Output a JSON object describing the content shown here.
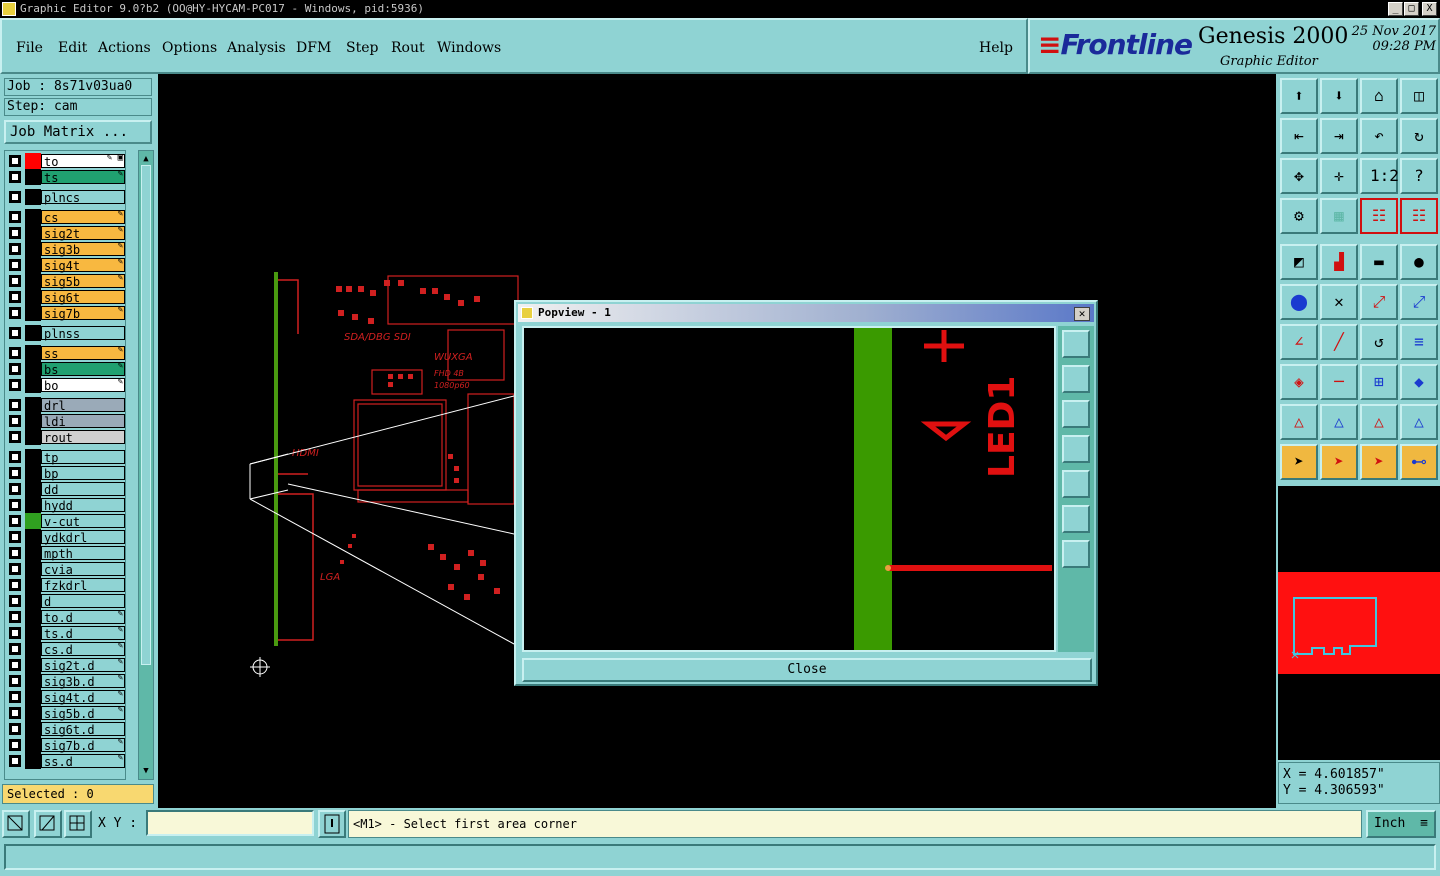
{
  "window": {
    "title": "Graphic Editor 9.0?b2 (OO@HY-HYCAM-PC017 - Windows, pid:5936)",
    "min": "_",
    "max": "□",
    "close": "X"
  },
  "menu": [
    "File",
    "Edit",
    "Actions",
    "Options",
    "Analysis",
    "DFM",
    "Step",
    "Rout",
    "Windows"
  ],
  "help": "Help",
  "brand": {
    "logo": "Frontline",
    "product": "Genesis 2000",
    "subtitle": "Graphic Editor",
    "date": "25 Nov 2017",
    "time": "09:28 PM"
  },
  "job": {
    "job_label": "Job : 8s71v03ua0",
    "step_label": "Step: cam",
    "matrix_button": "Job Matrix ..."
  },
  "layers": [
    {
      "name": "to",
      "color": "#ffffff",
      "swatch": "#ff0000",
      "icon": "✎ ▣"
    },
    {
      "name": "ts",
      "color": "#20a070",
      "swatch": "#000000",
      "icon": "✎"
    },
    {
      "name": "plncs",
      "color": "#8fd3d3",
      "swatch": "#000000",
      "icon": ""
    },
    {
      "name": "cs",
      "color": "#f8b840",
      "swatch": "#000000",
      "icon": "✎"
    },
    {
      "name": "sig2t",
      "color": "#f8b840",
      "swatch": "#000000",
      "icon": "✎"
    },
    {
      "name": "sig3b",
      "color": "#f8b840",
      "swatch": "#000000",
      "icon": "✎"
    },
    {
      "name": "sig4t",
      "color": "#f8b840",
      "swatch": "#000000",
      "icon": "✎"
    },
    {
      "name": "sig5b",
      "color": "#f8b840",
      "swatch": "#000000",
      "icon": "✎"
    },
    {
      "name": "sig6t",
      "color": "#f8b840",
      "swatch": "#000000",
      "icon": ""
    },
    {
      "name": "sig7b",
      "color": "#f8b840",
      "swatch": "#000000",
      "icon": "✎"
    },
    {
      "name": "plnss",
      "color": "#8fd3d3",
      "swatch": "#000000",
      "icon": ""
    },
    {
      "name": "ss",
      "color": "#f8b840",
      "swatch": "#000000",
      "icon": "✎"
    },
    {
      "name": "bs",
      "color": "#20a070",
      "swatch": "#000000",
      "icon": "✎"
    },
    {
      "name": "bo",
      "color": "#ffffff",
      "swatch": "#000000",
      "icon": "✎"
    },
    {
      "name": "drl",
      "color": "#9aaab8",
      "swatch": "#000000",
      "icon": ""
    },
    {
      "name": "ldi",
      "color": "#9aaab8",
      "swatch": "#000000",
      "icon": ""
    },
    {
      "name": "rout",
      "color": "#d0d0d0",
      "swatch": "#000000",
      "icon": ""
    },
    {
      "name": "tp",
      "color": "#8fd3d3",
      "swatch": "#000000",
      "icon": ""
    },
    {
      "name": "bp",
      "color": "#8fd3d3",
      "swatch": "#000000",
      "icon": ""
    },
    {
      "name": "dd",
      "color": "#8fd3d3",
      "swatch": "#000000",
      "icon": ""
    },
    {
      "name": "hydd",
      "color": "#8fd3d3",
      "swatch": "#000000",
      "icon": ""
    },
    {
      "name": "v-cut",
      "color": "#8fd3d3",
      "swatch": "#30a020",
      "icon": ""
    },
    {
      "name": "ydkdrl",
      "color": "#8fd3d3",
      "swatch": "#000000",
      "icon": ""
    },
    {
      "name": "mpth",
      "color": "#8fd3d3",
      "swatch": "#000000",
      "icon": ""
    },
    {
      "name": "cvia",
      "color": "#8fd3d3",
      "swatch": "#000000",
      "icon": ""
    },
    {
      "name": "fzkdrl",
      "color": "#8fd3d3",
      "swatch": "#000000",
      "icon": ""
    },
    {
      "name": "d",
      "color": "#8fd3d3",
      "swatch": "#000000",
      "icon": ""
    },
    {
      "name": "to.d",
      "color": "#8fd3d3",
      "swatch": "#000000",
      "icon": "✎"
    },
    {
      "name": "ts.d",
      "color": "#8fd3d3",
      "swatch": "#000000",
      "icon": "✎"
    },
    {
      "name": "cs.d",
      "color": "#8fd3d3",
      "swatch": "#000000",
      "icon": "✎"
    },
    {
      "name": "sig2t.d",
      "color": "#8fd3d3",
      "swatch": "#000000",
      "icon": "✎"
    },
    {
      "name": "sig3b.d",
      "color": "#8fd3d3",
      "swatch": "#000000",
      "icon": "✎"
    },
    {
      "name": "sig4t.d",
      "color": "#8fd3d3",
      "swatch": "#000000",
      "icon": "✎"
    },
    {
      "name": "sig5b.d",
      "color": "#8fd3d3",
      "swatch": "#000000",
      "icon": "✎"
    },
    {
      "name": "sig6t.d",
      "color": "#8fd3d3",
      "swatch": "#000000",
      "icon": ""
    },
    {
      "name": "sig7b.d",
      "color": "#8fd3d3",
      "swatch": "#000000",
      "icon": "✎"
    },
    {
      "name": "ss.d",
      "color": "#8fd3d3",
      "swatch": "#000000",
      "icon": "✎"
    }
  ],
  "selected": "Selected : 0",
  "board": {
    "labels": [
      "SDA/DBG SDI",
      "WUXGA",
      "FHD 4B",
      "1080p60",
      "HDMI",
      "LGA"
    ]
  },
  "popview": {
    "title": "Popview - 1",
    "close_button": "Close",
    "component_label": "LED1"
  },
  "coords": {
    "x": "X = 4.601857\"",
    "y": "Y = 4.306593\""
  },
  "status": {
    "xy_label": "X Y :",
    "xy_value": "",
    "prompt": "<M1> - Select first area corner",
    "unit": "Inch"
  },
  "tool_icons": [
    "zoom-home-icon",
    "zoom-page-icon",
    "home-icon",
    "split-view-icon",
    "pan-left-icon",
    "pan-right-icon",
    "undo-zoom-icon",
    "redraw-icon",
    "fit-icon",
    "center-icon",
    "scale-1-2-icon",
    "help-icon",
    "settings-icon",
    "grid-icon",
    "layer-display-icon",
    "layer-filter-icon",
    "select-icon",
    "measure-icon",
    "ruler-icon",
    "snap-icon",
    "connect-icon",
    "cross-icon",
    "point-icon",
    "point-alt-icon",
    "angle-icon",
    "line-icon",
    "arc-icon",
    "text-icon",
    "shape-icon",
    "minus-icon",
    "pad-icon",
    "group-icon",
    "triangle-icon",
    "triangle-alt-icon",
    "triangle-fill-icon",
    "triangle-line-icon",
    "cursor-icon",
    "cursor-box-icon",
    "cursor-alt-icon",
    "net-icon"
  ]
}
